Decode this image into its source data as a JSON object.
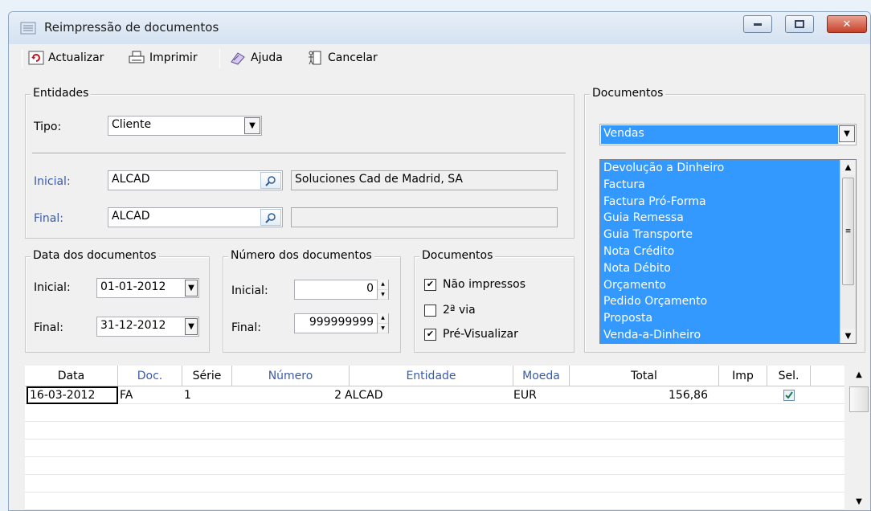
{
  "window": {
    "title": "Reimpressão de documentos"
  },
  "toolbar": {
    "actualizar": "Actualizar",
    "imprimir": "Imprimir",
    "ajuda": "Ajuda",
    "cancelar": "Cancelar"
  },
  "entidades": {
    "legend": "Entidades",
    "tipo_label": "Tipo:",
    "tipo_value": "Cliente",
    "inicial_label": "Inicial:",
    "inicial_code": "ALCAD",
    "inicial_name": "Soluciones Cad de Madrid, SA",
    "final_label": "Final:",
    "final_code": "ALCAD",
    "final_name": ""
  },
  "data_docs": {
    "legend": "Data dos documentos",
    "inicial_label": "Inicial:",
    "inicial_value": "01-01-2012",
    "final_label": "Final:",
    "final_value": "31-12-2012"
  },
  "numero_docs": {
    "legend": "Número dos documentos",
    "inicial_label": "Inicial:",
    "inicial_value": "0",
    "final_label": "Final:",
    "final_value": "999999999"
  },
  "documentos_opts": {
    "legend": "Documentos",
    "nao_impressos": {
      "label": "Não impressos",
      "checked": true
    },
    "segunda_via": {
      "label": "2ª via",
      "checked": false
    },
    "pre_visualizar": {
      "label": "Pré-Visualizar",
      "checked": true
    }
  },
  "documentos": {
    "legend": "Documentos",
    "combo_value": "Vendas",
    "items": [
      "Devolução a Dinheiro",
      "Factura",
      "Factura Pró-Forma",
      "Guia Remessa",
      "Guia Transporte",
      "Nota Crédito",
      "Nota Débito",
      "Orçamento",
      "Pedido Orçamento",
      "Proposta",
      "Venda-a-Dinheiro"
    ]
  },
  "grid": {
    "headers": {
      "data": "Data",
      "doc": "Doc.",
      "serie": "Série",
      "numero": "Número",
      "entidade": "Entidade",
      "moeda": "Moeda",
      "total": "Total",
      "imp": "Imp",
      "sel": "Sel."
    },
    "rows": [
      {
        "data": "16-03-2012",
        "doc": "FA",
        "serie": "1",
        "numero": "2",
        "entidade": "ALCAD",
        "moeda": "EUR",
        "total": "156,86",
        "imp": "",
        "sel": true
      }
    ]
  },
  "colors": {
    "selection": "#3399ff",
    "label_blue": "#3b5aa8"
  }
}
